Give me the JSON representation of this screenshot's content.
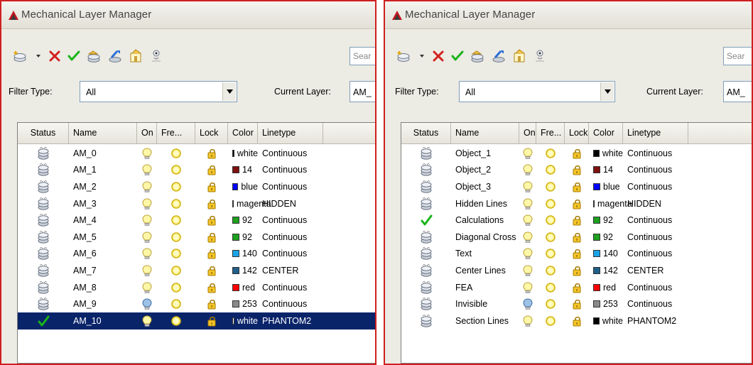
{
  "left": {
    "title": "Mechanical Layer Manager",
    "search_placeholder": "Sear",
    "filter_label": "Filter Type:",
    "filter_value": "All",
    "current_layer_label": "Current Layer:",
    "current_layer_value": "AM_",
    "columns": [
      "Status",
      "Name",
      "On",
      "Fre...",
      "Lock",
      "Color",
      "Linetype"
    ],
    "rows": [
      {
        "status": "layer",
        "name": "AM_0",
        "on": "on",
        "freeze": "thawed",
        "lock": "unlocked",
        "color_name": "white",
        "color_hex": "#000000",
        "linetype": "Continuous"
      },
      {
        "status": "layer",
        "name": "AM_1",
        "on": "on",
        "freeze": "thawed",
        "lock": "unlocked",
        "color_name": "14",
        "color_hex": "#7f1010",
        "linetype": "Continuous"
      },
      {
        "status": "layer",
        "name": "AM_2",
        "on": "on",
        "freeze": "thawed",
        "lock": "unlocked",
        "color_name": "blue",
        "color_hex": "#0000ff",
        "linetype": "Continuous"
      },
      {
        "status": "layer",
        "name": "AM_3",
        "on": "on",
        "freeze": "thawed",
        "lock": "unlocked",
        "color_name": "magenta",
        "color_hex": "#ff00ff",
        "linetype": "HIDDEN"
      },
      {
        "status": "layer",
        "name": "AM_4",
        "on": "on",
        "freeze": "thawed",
        "lock": "unlocked",
        "color_name": "92",
        "color_hex": "#1fa01f",
        "linetype": "Continuous"
      },
      {
        "status": "layer",
        "name": "AM_5",
        "on": "on",
        "freeze": "thawed",
        "lock": "unlocked",
        "color_name": "92",
        "color_hex": "#1fa01f",
        "linetype": "Continuous"
      },
      {
        "status": "layer",
        "name": "AM_6",
        "on": "on",
        "freeze": "thawed",
        "lock": "unlocked",
        "color_name": "140",
        "color_hex": "#1aa3e8",
        "linetype": "Continuous"
      },
      {
        "status": "layer",
        "name": "AM_7",
        "on": "on",
        "freeze": "thawed",
        "lock": "unlocked",
        "color_name": "142",
        "color_hex": "#1f5f8a",
        "linetype": "CENTER"
      },
      {
        "status": "layer",
        "name": "AM_8",
        "on": "on",
        "freeze": "thawed",
        "lock": "unlocked",
        "color_name": "red",
        "color_hex": "#ff0000",
        "linetype": "Continuous"
      },
      {
        "status": "layer",
        "name": "AM_9",
        "on": "off",
        "freeze": "thawed",
        "lock": "unlocked",
        "color_name": "253",
        "color_hex": "#8a8a8a",
        "linetype": "Continuous"
      },
      {
        "status": "current",
        "name": "AM_10",
        "on": "on",
        "freeze": "thawed",
        "lock": "unlocked",
        "color_name": "white",
        "color_hex": "#ffffff",
        "linetype": "PHANTOM2",
        "selected": true
      }
    ]
  },
  "right": {
    "title": "Mechanical Layer Manager",
    "search_placeholder": "Sear",
    "filter_label": "Filter Type:",
    "filter_value": "All",
    "current_layer_label": "Current Layer:",
    "current_layer_value": "AM_",
    "columns": [
      "Status",
      "Name",
      "On",
      "Fre...",
      "Lock",
      "Color",
      "Linetype"
    ],
    "rows": [
      {
        "status": "layer",
        "name": "Object_1",
        "on": "on",
        "freeze": "thawed",
        "lock": "unlocked",
        "color_name": "white",
        "color_hex": "#000000",
        "linetype": "Continuous"
      },
      {
        "status": "layer",
        "name": "Object_2",
        "on": "on",
        "freeze": "thawed",
        "lock": "unlocked",
        "color_name": "14",
        "color_hex": "#7f1010",
        "linetype": "Continuous"
      },
      {
        "status": "layer",
        "name": "Object_3",
        "on": "on",
        "freeze": "thawed",
        "lock": "unlocked",
        "color_name": "blue",
        "color_hex": "#0000ff",
        "linetype": "Continuous"
      },
      {
        "status": "layer",
        "name": "Hidden Lines",
        "on": "on",
        "freeze": "thawed",
        "lock": "unlocked",
        "color_name": "magenta",
        "color_hex": "#ff00ff",
        "linetype": "HIDDEN"
      },
      {
        "status": "current",
        "name": "Calculations",
        "on": "on",
        "freeze": "thawed",
        "lock": "unlocked",
        "color_name": "92",
        "color_hex": "#1fa01f",
        "linetype": "Continuous"
      },
      {
        "status": "layer",
        "name": "Diagonal Cross",
        "on": "on",
        "freeze": "thawed",
        "lock": "unlocked",
        "color_name": "92",
        "color_hex": "#1fa01f",
        "linetype": "Continuous"
      },
      {
        "status": "layer",
        "name": "Text",
        "on": "on",
        "freeze": "thawed",
        "lock": "unlocked",
        "color_name": "140",
        "color_hex": "#1aa3e8",
        "linetype": "Continuous"
      },
      {
        "status": "layer",
        "name": "Center Lines",
        "on": "on",
        "freeze": "thawed",
        "lock": "unlocked",
        "color_name": "142",
        "color_hex": "#1f5f8a",
        "linetype": "CENTER"
      },
      {
        "status": "layer",
        "name": "FEA",
        "on": "on",
        "freeze": "thawed",
        "lock": "unlocked",
        "color_name": "red",
        "color_hex": "#ff0000",
        "linetype": "Continuous"
      },
      {
        "status": "layer",
        "name": "Invisible",
        "on": "off",
        "freeze": "thawed",
        "lock": "unlocked",
        "color_name": "253",
        "color_hex": "#8a8a8a",
        "linetype": "Continuous"
      },
      {
        "status": "layer",
        "name": "Section Lines",
        "on": "on",
        "freeze": "thawed",
        "lock": "unlocked",
        "color_name": "white",
        "color_hex": "#000000",
        "linetype": "PHANTOM2"
      }
    ]
  },
  "toolbar_icons": [
    "new-layer-icon",
    "dropdown-arrow-icon",
    "delete-layer-icon",
    "set-current-icon",
    "layer-states-icon",
    "layer-settings-icon",
    "isolate-layer-icon",
    "layer-walk-icon"
  ]
}
